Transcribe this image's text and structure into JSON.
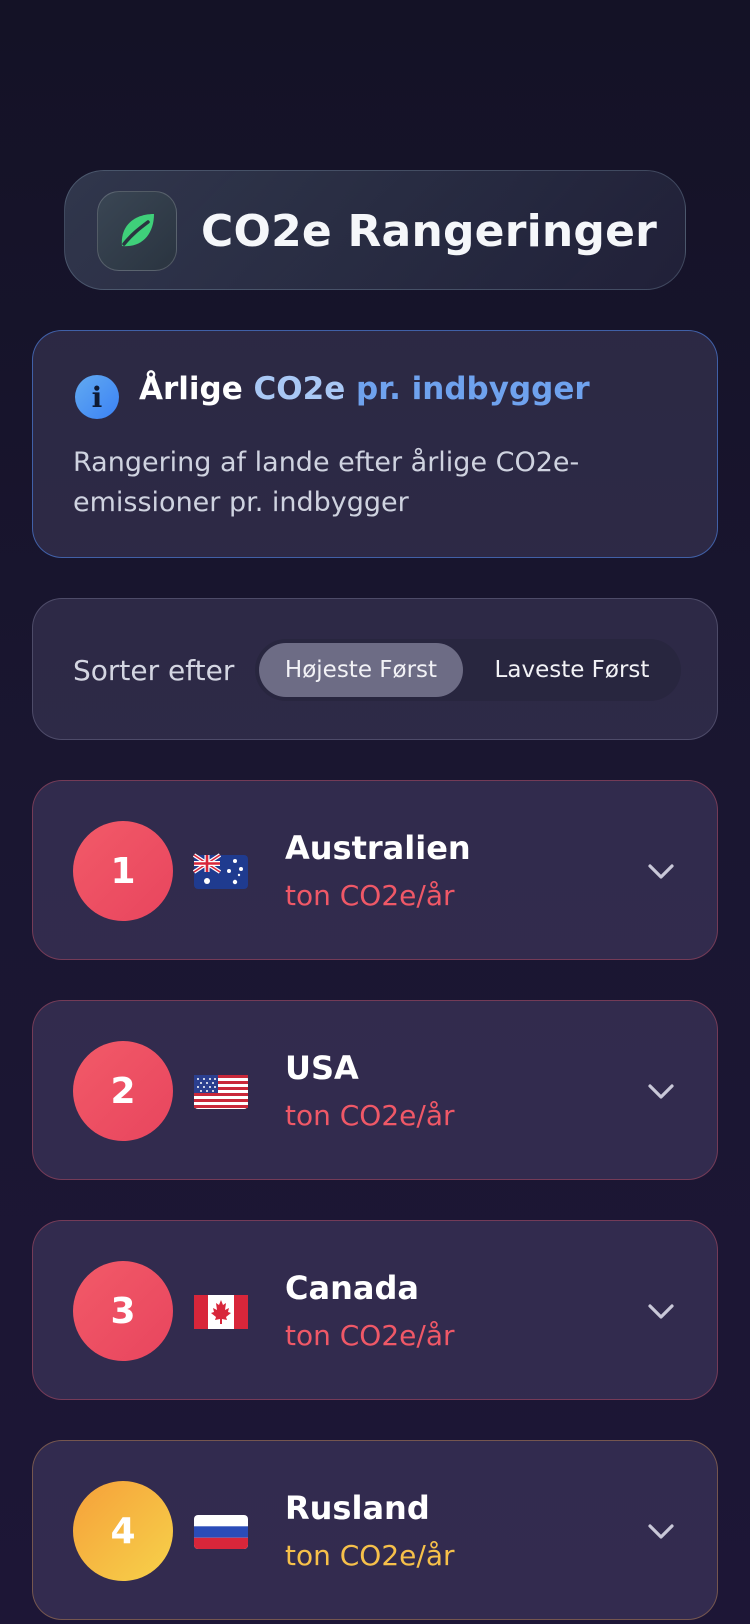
{
  "header": {
    "title": "CO2e Rangeringer",
    "logo_icon": "leaf-icon",
    "accent": "#3fd07a"
  },
  "info": {
    "icon": "info-icon",
    "title_part1": "Årlige ",
    "title_part2": "CO2e",
    "title_part3": " pr. indbygger",
    "description": "Rangering af lande efter årlige CO2e-emissioner pr. indbygger",
    "border_color": "#4a78d2"
  },
  "sort": {
    "label": "Sorter efter",
    "options": [
      "Højeste Først",
      "Laveste Først"
    ],
    "selected": "Højeste Først"
  },
  "rankings": [
    {
      "rank": "1",
      "country": "Australien",
      "unit": "ton CO2e/år",
      "flag": "australia-flag-icon",
      "color": "#ef5867",
      "unit_color": "#ef5867"
    },
    {
      "rank": "2",
      "country": "USA",
      "unit": "ton CO2e/år",
      "flag": "usa-flag-icon",
      "color": "#ef5867",
      "unit_color": "#ef5867"
    },
    {
      "rank": "3",
      "country": "Canada",
      "unit": "ton CO2e/år",
      "flag": "canada-flag-icon",
      "color": "#ef5867",
      "unit_color": "#ef5867"
    },
    {
      "rank": "4",
      "country": "Rusland",
      "unit": "ton CO2e/år",
      "flag": "russia-flag-icon",
      "color": "#f6b93b",
      "unit_color": "#f6c04a"
    }
  ]
}
